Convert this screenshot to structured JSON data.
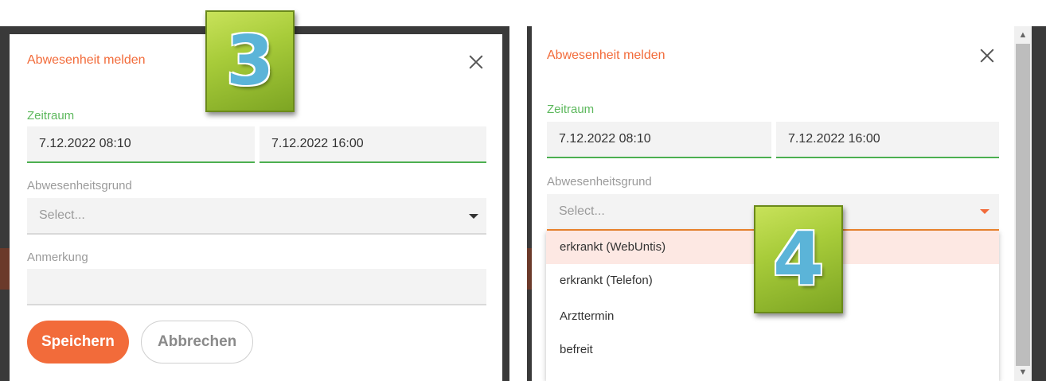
{
  "step_badges": {
    "left": "3",
    "right": "4"
  },
  "left_dialog": {
    "title": "Abwesenheit melden",
    "period_label": "Zeitraum",
    "start": "7.12.2022 08:10",
    "end": "7.12.2022 16:00",
    "reason_label": "Abwesenheitsgrund",
    "reason_placeholder": "Select...",
    "note_label": "Anmerkung",
    "note_value": "",
    "save_label": "Speichern",
    "cancel_label": "Abbrechen"
  },
  "right_dialog": {
    "title": "Abwesenheit melden",
    "period_label": "Zeitraum",
    "start": "7.12.2022 08:10",
    "end": "7.12.2022 16:00",
    "reason_label": "Abwesenheitsgrund",
    "reason_placeholder": "Select...",
    "options": [
      "erkrankt (WebUntis)",
      "erkrankt (Telefon)",
      "Arzttermin",
      "befreit"
    ],
    "highlighted_option": "erkrankt (WebUntis)"
  },
  "colors": {
    "accent": "#f26b3a",
    "label_green": "#5cb85c",
    "underline_green": "#4caf50",
    "highlight": "#fde8e3"
  }
}
